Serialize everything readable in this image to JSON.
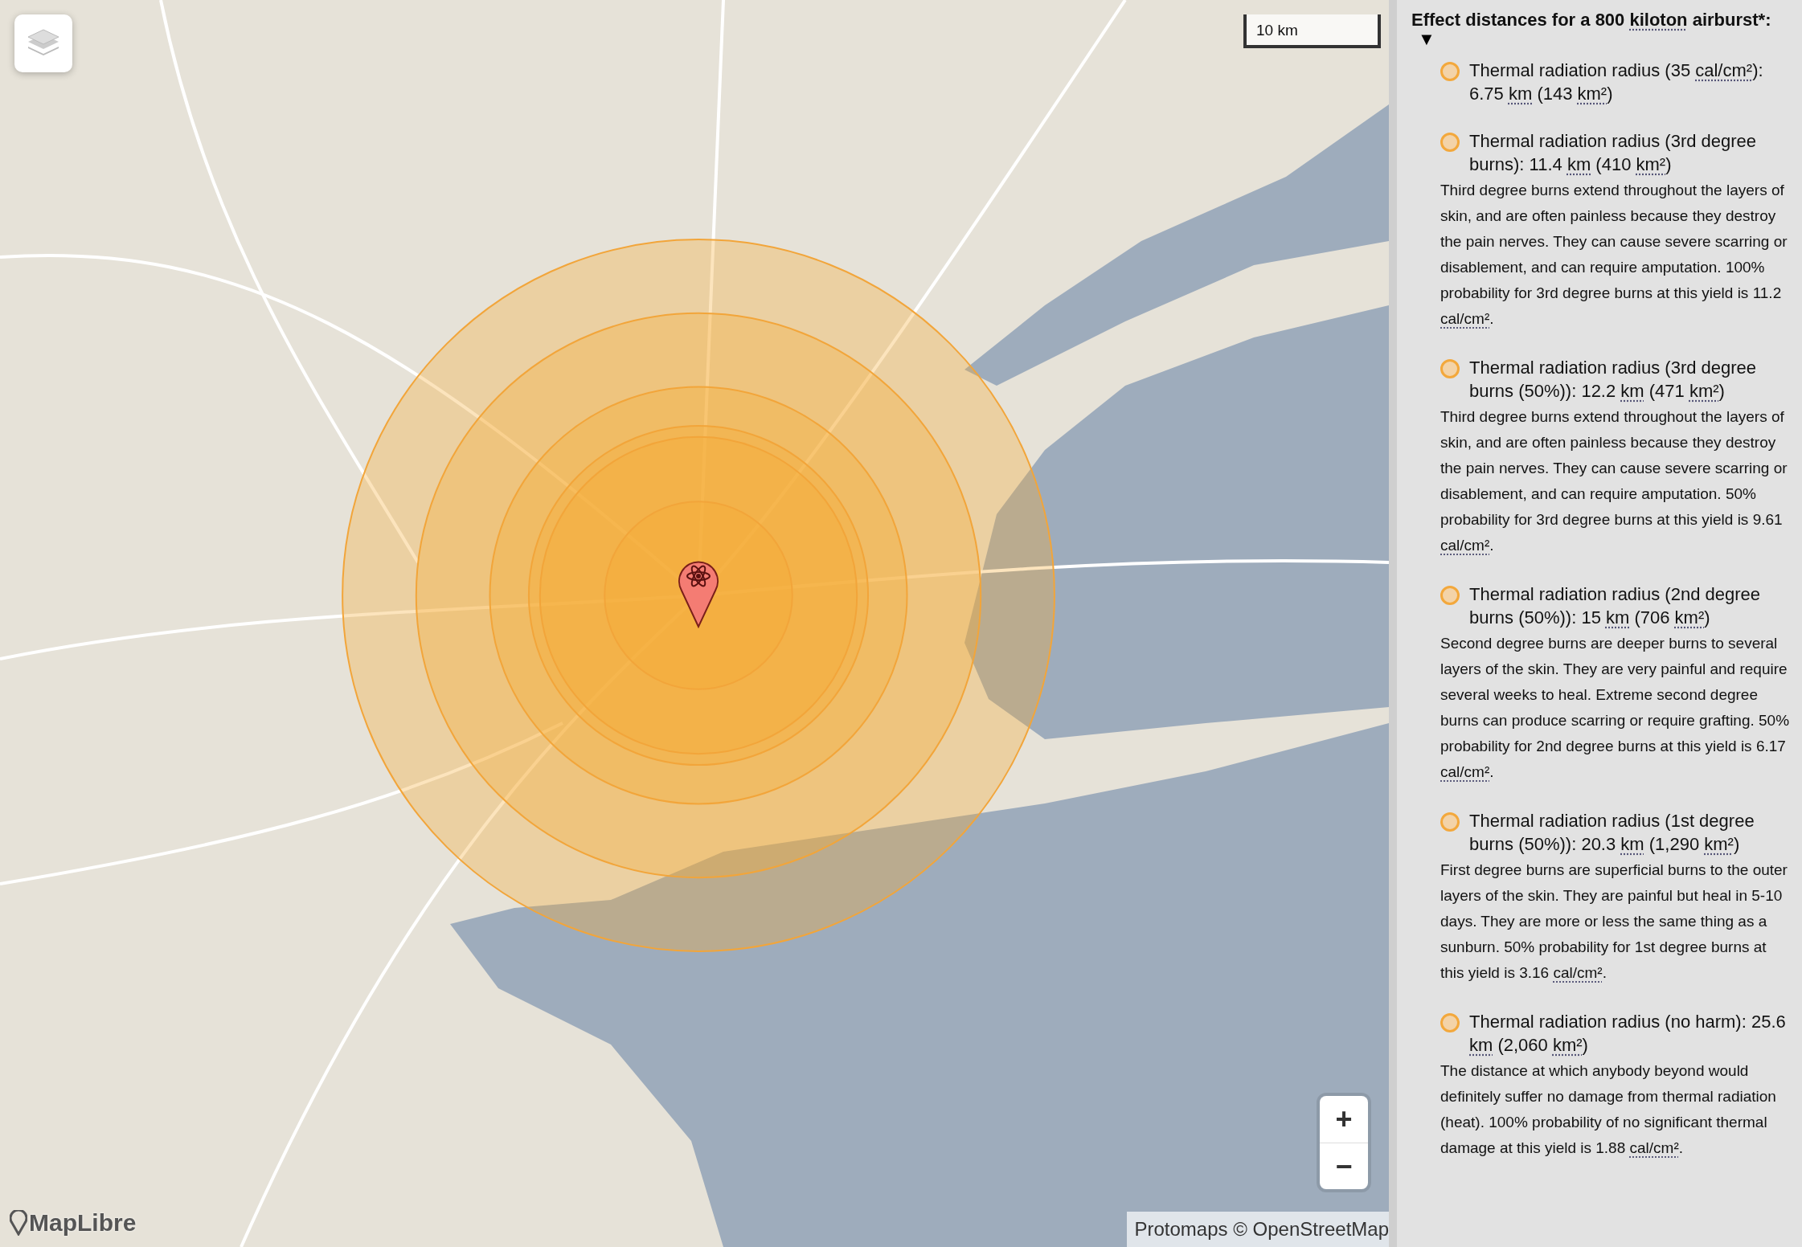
{
  "map": {
    "scale": "10 km",
    "zoom_in": "+",
    "zoom_out": "−",
    "attribution": "Protomaps © OpenStreetMap",
    "logo": "MapLibre"
  },
  "panel": {
    "heading": [
      {
        "kind": "text",
        "text": "Effect distances for a 800 "
      },
      {
        "kind": "abbr",
        "text": "kiloton"
      },
      {
        "kind": "text",
        "text": " airburst*:"
      }
    ],
    "toggle": "▼",
    "expanded": true,
    "effects": [
      {
        "title": [
          {
            "kind": "text",
            "text": "Thermal radiation radius (35 "
          },
          {
            "kind": "abbr",
            "text": "cal/cm²"
          },
          {
            "kind": "text",
            "text": "): "
          },
          {
            "kind": "distance",
            "text": "6.75 "
          },
          {
            "kind": "abbr",
            "text": "km"
          },
          {
            "kind": "text",
            "text": " (143 "
          },
          {
            "kind": "abbr",
            "text": "km²"
          },
          {
            "kind": "text",
            "text": ")"
          }
        ]
      },
      {
        "title": [
          {
            "kind": "text",
            "text": "Thermal radiation radius (3rd degree burns): "
          },
          {
            "kind": "distance",
            "text": "11.4 "
          },
          {
            "kind": "abbr",
            "text": "km"
          },
          {
            "kind": "text",
            "text": " (410 "
          },
          {
            "kind": "abbr",
            "text": "km²"
          },
          {
            "kind": "text",
            "text": ")"
          }
        ],
        "description": [
          {
            "kind": "text",
            "text": "Third degree burns extend throughout the layers of skin, and are often painless because they destroy the pain nerves. They can cause severe scarring or disablement, and can require amputation. 100% probability for 3rd degree burns at this yield is 11.2 "
          },
          {
            "kind": "abbr",
            "text": "cal/cm²"
          },
          {
            "kind": "text",
            "text": "."
          }
        ]
      },
      {
        "title": [
          {
            "kind": "text",
            "text": "Thermal radiation radius (3rd degree burns (50%)): "
          },
          {
            "kind": "distance",
            "text": "12.2 "
          },
          {
            "kind": "abbr",
            "text": "km"
          },
          {
            "kind": "text",
            "text": " (471 "
          },
          {
            "kind": "abbr",
            "text": "km²"
          },
          {
            "kind": "text",
            "text": ")"
          }
        ],
        "description": [
          {
            "kind": "text",
            "text": "Third degree burns extend throughout the layers of skin, and are often painless because they destroy the pain nerves. They can cause severe scarring or disablement, and can require amputation. 50% probability for 3rd degree burns at this yield is 9.61 "
          },
          {
            "kind": "abbr",
            "text": "cal/cm²"
          },
          {
            "kind": "text",
            "text": "."
          }
        ]
      },
      {
        "title": [
          {
            "kind": "text",
            "text": "Thermal radiation radius (2nd degree burns (50%)): "
          },
          {
            "kind": "distance",
            "text": "15 "
          },
          {
            "kind": "abbr",
            "text": "km"
          },
          {
            "kind": "text",
            "text": " (706 "
          },
          {
            "kind": "abbr",
            "text": "km²"
          },
          {
            "kind": "text",
            "text": ")"
          }
        ],
        "description": [
          {
            "kind": "text",
            "text": "Second degree burns are deeper burns to several layers of the skin. They are very painful and require several weeks to heal. Extreme second degree burns can produce scarring or require grafting. 50% probability for 2nd degree burns at this yield is 6.17 "
          },
          {
            "kind": "abbr",
            "text": "cal/cm²"
          },
          {
            "kind": "text",
            "text": "."
          }
        ]
      },
      {
        "title": [
          {
            "kind": "text",
            "text": "Thermal radiation radius (1st degree burns (50%)): "
          },
          {
            "kind": "distance",
            "text": "20.3 "
          },
          {
            "kind": "abbr",
            "text": "km"
          },
          {
            "kind": "text",
            "text": " (1,290 "
          },
          {
            "kind": "abbr",
            "text": "km²"
          },
          {
            "kind": "text",
            "text": ")"
          }
        ],
        "description": [
          {
            "kind": "text",
            "text": "First degree burns are superficial burns to the outer layers of the skin. They are painful but heal in 5-10 days. They are more or less the same thing as a sunburn. 50% probability for 1st degree burns at this yield is 3.16 "
          },
          {
            "kind": "abbr",
            "text": "cal/cm²"
          },
          {
            "kind": "text",
            "text": "."
          }
        ]
      },
      {
        "title": [
          {
            "kind": "text",
            "text": "Thermal radiation radius (no harm): "
          },
          {
            "kind": "distance",
            "text": "25.6 "
          },
          {
            "kind": "abbr",
            "text": "km"
          },
          {
            "kind": "text",
            "text": " (2,060 "
          },
          {
            "kind": "abbr",
            "text": "km²"
          },
          {
            "kind": "text",
            "text": ")"
          }
        ],
        "description": [
          {
            "kind": "text",
            "text": "The distance at which anybody beyond would definitely suffer no damage from thermal radiation (heat). 100% probability of no significant thermal damage at this yield is 1.88 "
          },
          {
            "kind": "abbr",
            "text": "cal/cm²"
          },
          {
            "kind": "text",
            "text": "."
          }
        ]
      }
    ]
  }
}
